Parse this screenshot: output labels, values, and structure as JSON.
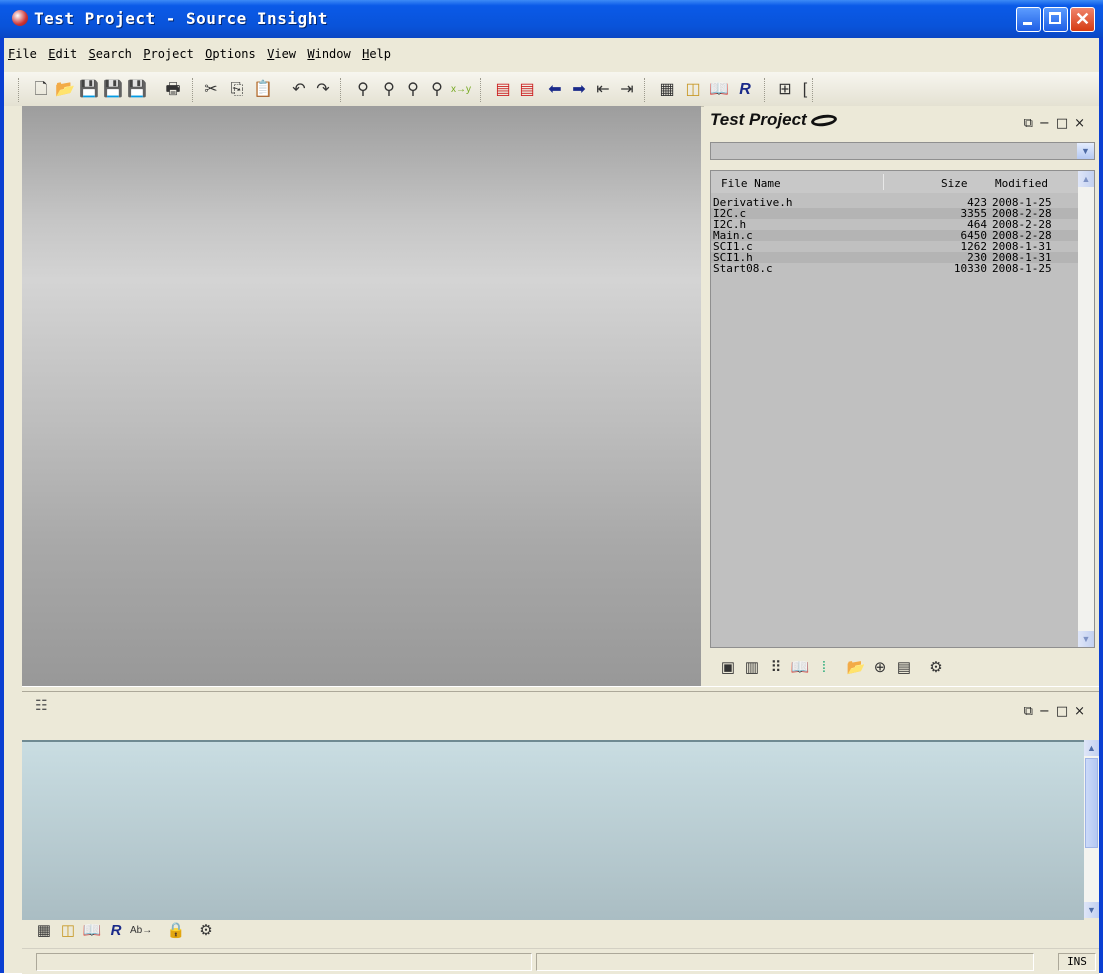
{
  "window": {
    "title": "Test Project - Source Insight"
  },
  "menu": [
    {
      "key": "F",
      "rest": "ile"
    },
    {
      "key": "E",
      "rest": "dit"
    },
    {
      "key": "S",
      "rest": "earch"
    },
    {
      "key": "P",
      "rest": "roject"
    },
    {
      "key": "O",
      "rest": "ptions"
    },
    {
      "key": "V",
      "rest": "iew"
    },
    {
      "key": "W",
      "rest": "indow"
    },
    {
      "key": "H",
      "rest": "elp"
    }
  ],
  "project_panel": {
    "title": "Test Project",
    "columns": {
      "name": "File Name",
      "size": "Size",
      "modified": "Modified"
    },
    "files": [
      {
        "name": "Derivative.h",
        "size": "423",
        "modified": "2008-1-25"
      },
      {
        "name": "I2C.c",
        "size": "3355",
        "modified": "2008-2-28"
      },
      {
        "name": "I2C.h",
        "size": "464",
        "modified": "2008-2-28"
      },
      {
        "name": "Main.c",
        "size": "6450",
        "modified": "2008-2-28"
      },
      {
        "name": "SCI1.c",
        "size": "1262",
        "modified": "2008-1-31"
      },
      {
        "name": "SCI1.h",
        "size": "230",
        "modified": "2008-1-31"
      },
      {
        "name": "Start08.c",
        "size": "10330",
        "modified": "2008-1-25"
      }
    ]
  },
  "statusbar": {
    "mode": "INS"
  },
  "colors": {
    "title_bar": "#0a5ae8",
    "chrome": "#ece9d8",
    "context_area": "#bccfd4",
    "editor_gray": "#b9b9b9"
  }
}
